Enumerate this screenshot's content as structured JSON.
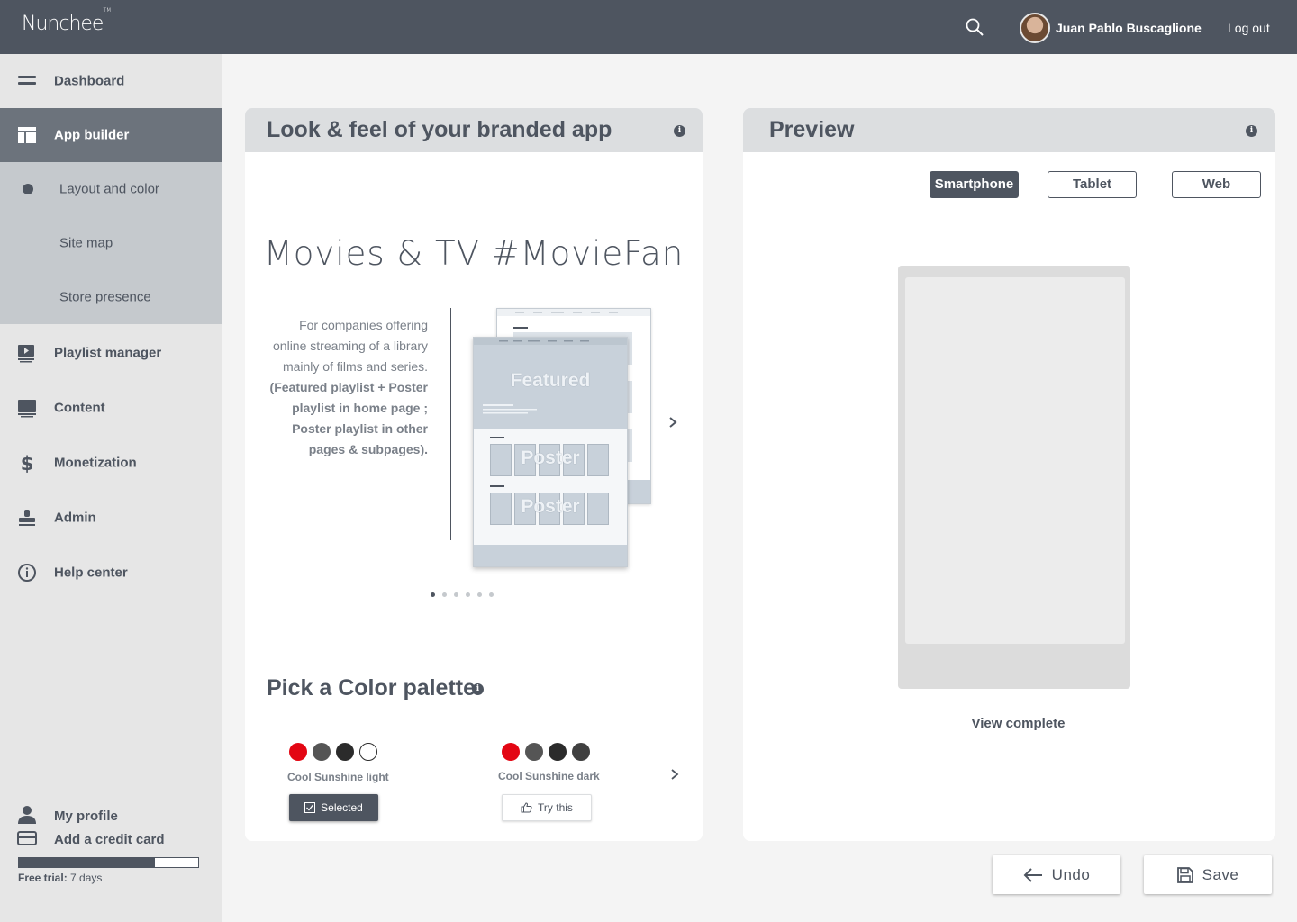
{
  "brand": {
    "name": "Nunchee",
    "trademark": "TM"
  },
  "header": {
    "user_name": "Juan Pablo Buscaglione",
    "logout_label": "Log out",
    "search_icon": "search-icon"
  },
  "sidebar": {
    "items": [
      {
        "label": "Dashboard",
        "icon": "dashboard-icon"
      },
      {
        "label": "App builder",
        "icon": "app-builder-icon",
        "active": true
      },
      {
        "label": "Playlist manager",
        "icon": "playlist-icon"
      },
      {
        "label": "Content",
        "icon": "monitor-icon"
      },
      {
        "label": "Monetization",
        "icon": "dollar-icon"
      },
      {
        "label": "Admin",
        "icon": "stamp-icon"
      },
      {
        "label": "Help center",
        "icon": "info-circle-icon"
      }
    ],
    "subitems": [
      {
        "label": "Layout and color",
        "active": true
      },
      {
        "label": "Site map"
      },
      {
        "label": "Store presence"
      }
    ],
    "bottom": {
      "profile_label": "My profile",
      "credit_card_label": "Add a credit card",
      "trial_label": "Free trial:",
      "trial_value": "7 days",
      "trial_progress": 0.76
    }
  },
  "look_feel": {
    "title": "Look & feel of your branded app",
    "template_title": "Movies & TV #MovieFan",
    "description": "For companies offering online streaming of a library mainly of films and series.",
    "description_bold": "(Featured playlist + Poster playlist in home page ; Poster playlist in other pages & subpages).",
    "mockup": {
      "featured_label": "Featured",
      "poster_label_1": "Poster",
      "poster_label_2": "Poster"
    },
    "carousel": {
      "total": 6,
      "active": 0
    }
  },
  "palette": {
    "title": "Pick a Color palette",
    "options": [
      {
        "name": "Cool Sunshine light",
        "colors": [
          "#e30613",
          "#555555",
          "#2b2b2b",
          "#ffffff"
        ],
        "button": "Selected",
        "button_icon": "checkbox-icon"
      },
      {
        "name": "Cool Sunshine dark",
        "colors": [
          "#e30613",
          "#555555",
          "#2b2b2b",
          "#404040"
        ],
        "button": "Try this",
        "button_icon": "thumbs-up-icon"
      }
    ]
  },
  "preview": {
    "title": "Preview",
    "devices": [
      "Smartphone",
      "Tablet",
      "Web"
    ],
    "active_device": "Smartphone",
    "view_complete_label": "View complete"
  },
  "actions": {
    "undo_label": "Undo",
    "save_label": "Save"
  },
  "colors": {
    "header_bg": "#4e5560",
    "sidebar_bg": "#e6e6e6",
    "active_nav": "#6c737c",
    "subnav_bg": "#c5c9cd"
  }
}
